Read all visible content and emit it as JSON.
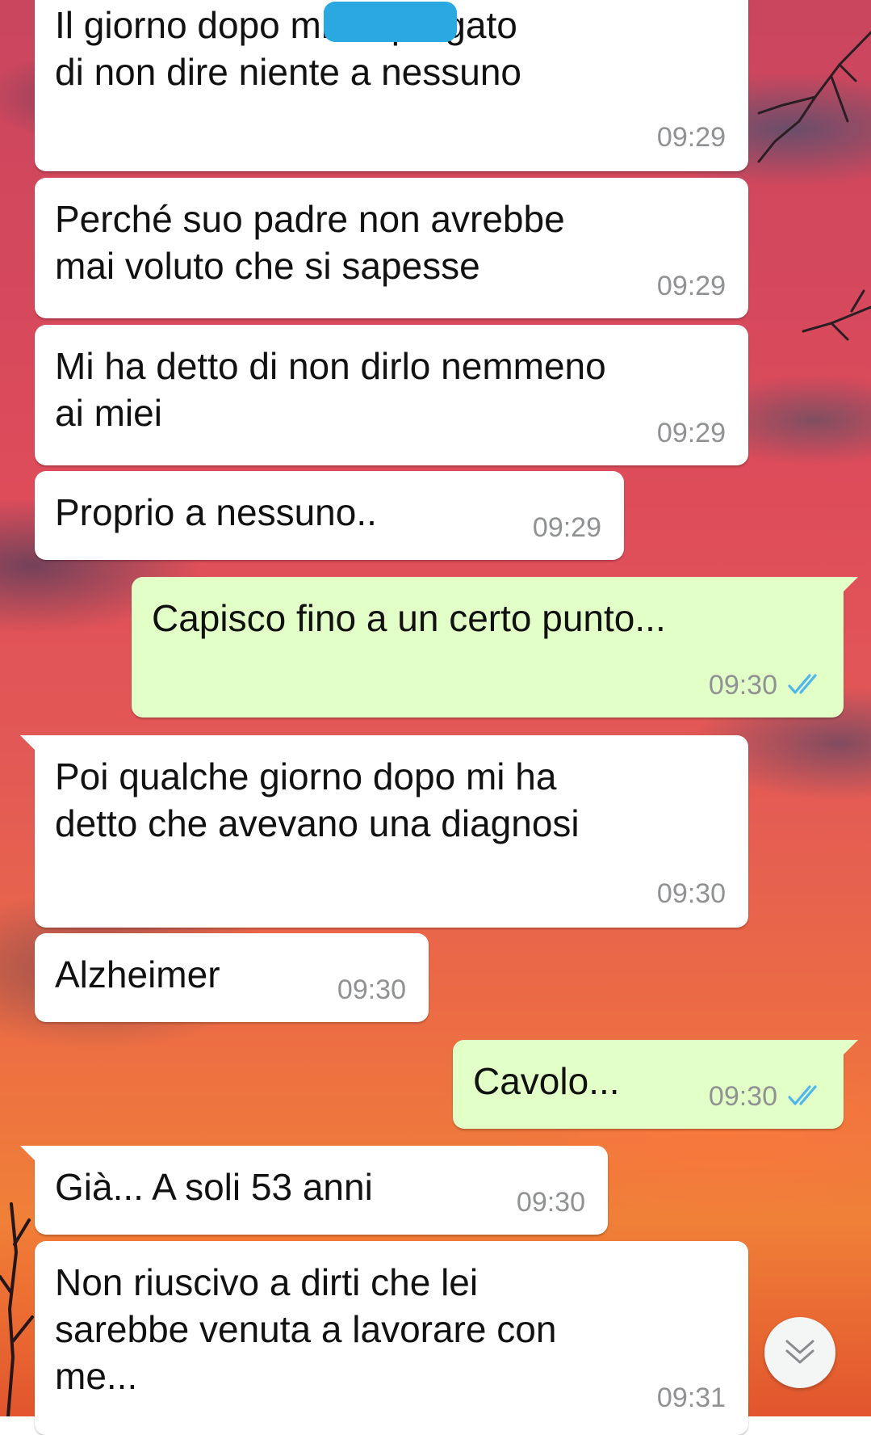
{
  "chat": {
    "colors": {
      "incoming_bubble": "#ffffff",
      "outgoing_bubble": "#e1ffc7",
      "timestamp": "#8f9193",
      "read_ticks": "#4fb6ec",
      "redaction": "#2aa9e0"
    },
    "messages": [
      {
        "direction": "incoming",
        "text": "Il giorno dopo            mi ha pregato\ndi non dire niente a nessuno",
        "time": "09:29",
        "partially_redacted": true
      },
      {
        "direction": "incoming",
        "text": "Perché suo padre non avrebbe\nmai voluto che si sapesse",
        "time": "09:29"
      },
      {
        "direction": "incoming",
        "text": "Mi ha detto di non dirlo nemmeno\nai miei",
        "time": "09:29"
      },
      {
        "direction": "incoming",
        "text": "Proprio a nessuno..",
        "time": "09:29"
      },
      {
        "direction": "outgoing",
        "text": "Capisco fino a un certo punto...",
        "time": "09:30",
        "status_icon": "double-check-read-icon"
      },
      {
        "direction": "incoming",
        "text": "Poi qualche giorno dopo mi ha\ndetto che avevano una diagnosi",
        "time": "09:30"
      },
      {
        "direction": "incoming",
        "text": "Alzheimer",
        "time": "09:30"
      },
      {
        "direction": "outgoing",
        "text": "Cavolo...",
        "time": "09:30",
        "status_icon": "double-check-read-icon"
      },
      {
        "direction": "incoming",
        "text": "Già... A soli 53 anni",
        "time": "09:30"
      },
      {
        "direction": "incoming",
        "text": "Non riuscivo a dirti che lei\nsarebbe venuta a lavorare con\nme...",
        "time": "09:31"
      }
    ],
    "scroll_button": {
      "icon": "double-chevron-down-icon"
    }
  }
}
